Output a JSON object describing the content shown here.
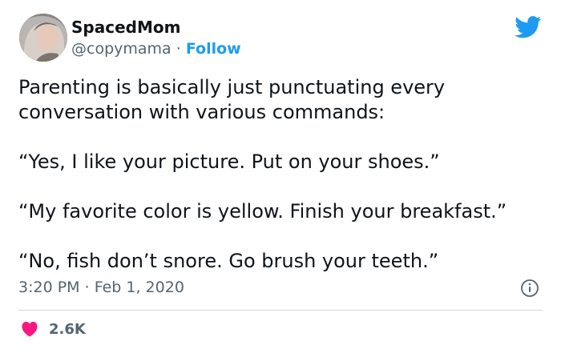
{
  "author": {
    "name": "SpacedMom",
    "handle": "@copymama",
    "separator": "·",
    "follow_label": "Follow"
  },
  "tweet": {
    "intro": "Parenting is basically just punctuating every conversation with various commands:",
    "quotes": [
      "“Yes, I like your picture. Put on your shoes.”",
      "“My favorite color is yellow. Finish your breakfast.”",
      "“No, fish don’t snore. Go brush your teeth.”"
    ]
  },
  "meta": {
    "time": "3:20 PM",
    "separator": "·",
    "date": "Feb 1, 2020"
  },
  "stats": {
    "likes": "2.6K"
  },
  "icons": {
    "brand": "twitter-bird-icon",
    "info": "info-icon",
    "like": "heart-icon"
  },
  "colors": {
    "twitter_blue": "#1d9bf0",
    "like_pink": "#f91880",
    "secondary_text": "#536471"
  }
}
